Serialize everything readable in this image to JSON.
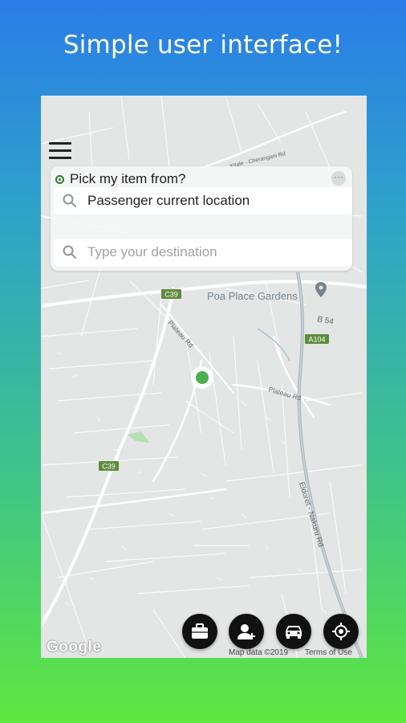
{
  "headline": "Simple user interface!",
  "search": {
    "pick_label": "Pick my item from?",
    "pickup_value": "Passenger current location",
    "destination_placeholder": "Type your destination"
  },
  "map": {
    "roads": {
      "c39_top": "C39",
      "c39_bottom": "C39",
      "a104": "A104",
      "b54": "B 54",
      "plateau_rd_1": "Plateau Rd",
      "plateau_rd_2": "Plateau Rd",
      "eldoret_nakuru_rd": "Eldoret - Nakuru Rd",
      "kitale_cherangani_rd": "Kitale - Cherangani Rd"
    },
    "poi": "Poa Place Gardens",
    "google": "Google",
    "map_data": "Map data ©2019",
    "terms": "Terms of Use"
  },
  "actions": [
    {
      "icon": "briefcase-icon"
    },
    {
      "icon": "add-person-icon"
    },
    {
      "icon": "car-icon"
    },
    {
      "icon": "my-location-icon"
    }
  ],
  "colors": {
    "accent_green": "#4caf50",
    "radio_green": "#2e7d32",
    "fab": "#111111"
  }
}
